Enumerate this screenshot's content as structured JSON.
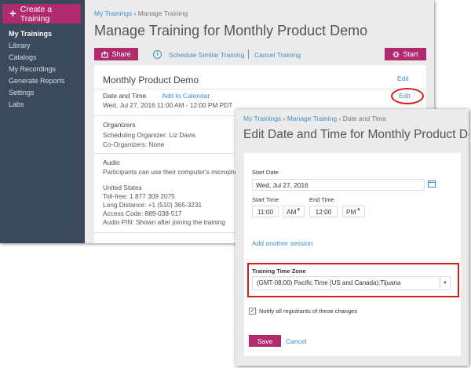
{
  "sidebar": {
    "create_label": "Create a Training",
    "items": [
      {
        "label": "My Trainings",
        "active": true
      },
      {
        "label": "Library"
      },
      {
        "label": "Catalogs"
      },
      {
        "label": "My Recordings"
      },
      {
        "label": "Generate Reports"
      },
      {
        "label": "Settings"
      },
      {
        "label": "Labs"
      }
    ]
  },
  "main": {
    "breadcrumb": {
      "link": "My Trainings",
      "sep": "›",
      "current": "Manage Training"
    },
    "title": "Manage Training for Monthly Product Demo",
    "toolbar": {
      "share_label": "Share",
      "schedule_similar": "Schedule Similar Training",
      "cancel_training": "Cancel Training",
      "start_label": "Start"
    },
    "card": {
      "title": "Monthly Product Demo",
      "edit": "Edit",
      "date_time": {
        "label": "Date and Time",
        "add_to_calendar": "Add to Calendar",
        "value": "Wed, Jul 27, 2016 11:00 AM - 12:00 PM PDT",
        "edit": "Edit"
      },
      "organizers": {
        "label": "Organizers",
        "scheduling": "Scheduling Organizer: Liz Davis",
        "co": "Co-Organizers: None"
      },
      "audio": {
        "label": "Audio",
        "desc": "Participants can use their computer's microphone",
        "country": "United States",
        "toll_free": "Toll-free: 1 877 309 2075",
        "long_distance": "Long Distance: +1 (510) 365-3231",
        "access_code": "Access Code: 889-038-517",
        "audio_pin": "Audio PIN: Shown after joining the training"
      }
    }
  },
  "dialog": {
    "breadcrumb": {
      "link1": "My Trainings",
      "sep": "›",
      "link2": "Manage Training",
      "current": "Date and Time"
    },
    "title": "Edit Date and Time for Monthly Product Demo",
    "start_date_label": "Start Date",
    "start_date_value": "Wed, Jul 27, 2016",
    "start_time_label": "Start Time",
    "start_time_value": "11:00",
    "start_ampm": "AM",
    "end_time_label": "End Time",
    "end_time_value": "12:00",
    "end_ampm": "PM",
    "add_session": "Add another session",
    "tz_label": "Training Time Zone",
    "tz_value": "(GMT-08:00) Pacific Time (US and Canada);Tijuana",
    "notify_checked": true,
    "notify_label": "Notify all registrants of these changes",
    "save_label": "Save",
    "cancel_label": "Cancel"
  },
  "colors": {
    "accent": "#b22a6e",
    "sidebar": "#3a4a5c",
    "link": "#3f8fc9",
    "highlight": "#d51d1d"
  }
}
